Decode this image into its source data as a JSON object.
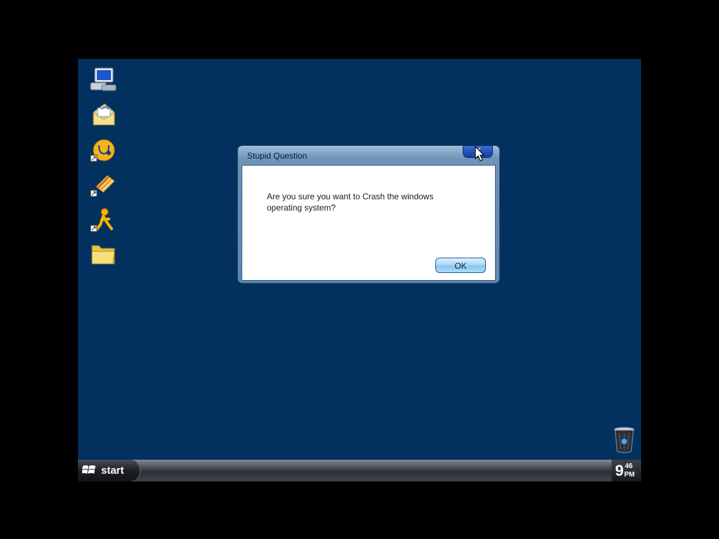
{
  "desktop": {
    "background_color": "#03315f",
    "icons": [
      {
        "name": "my-computer-icon"
      },
      {
        "name": "outlook-express-icon"
      },
      {
        "name": "help-support-icon"
      },
      {
        "name": "notepad-shortcut-icon"
      },
      {
        "name": "aim-messenger-icon"
      },
      {
        "name": "folder-icon"
      }
    ],
    "recycle_bin_icon": "recycle-bin-icon"
  },
  "dialog": {
    "title": "Stupid Question",
    "message": "Are you sure you want to Crash the windows operating system?",
    "ok_label": "OK",
    "close_label": "✕"
  },
  "taskbar": {
    "start_label": "start",
    "clock": {
      "hour": "9",
      "minute": "46",
      "ampm": "PM"
    }
  },
  "colors": {
    "accent": "#1f4fb2",
    "titlebar": "#6e94b9",
    "ok_button": "#a9d6f5"
  }
}
